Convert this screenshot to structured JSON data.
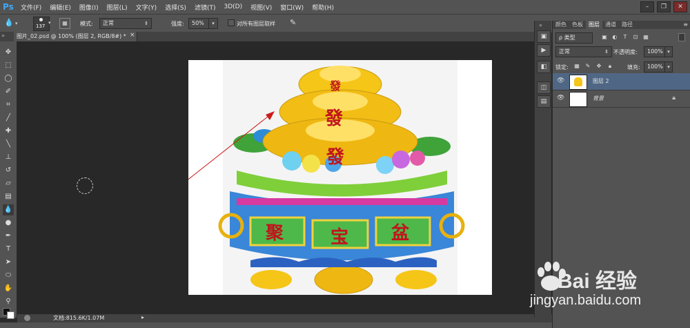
{
  "app": {
    "logo": "Ps",
    "menu": [
      "文件(F)",
      "编辑(E)",
      "图像(I)",
      "图层(L)",
      "文字(Y)",
      "选择(S)",
      "滤镜(T)",
      "3D(D)",
      "视图(V)",
      "窗口(W)",
      "帮助(H)"
    ]
  },
  "options": {
    "brush_size": "137",
    "mode_label": "模式:",
    "mode_value": "正常",
    "strength_label": "强度:",
    "strength_value": "50%",
    "sample_all_label": "对所有图层取样"
  },
  "document": {
    "tab_title": "图片_02.psd @ 100% (图层 2, RGB/8#) *",
    "status_text": "文档:815.6K/1.07M"
  },
  "artwork": {
    "characters": [
      "發",
      "發",
      "發"
    ],
    "pot_labels": [
      "聚",
      "宝",
      "盆"
    ]
  },
  "layers_panel": {
    "tabs": [
      "颜色",
      "色板",
      "图层",
      "通道",
      "路径"
    ],
    "active_tab": "图层",
    "filter_label": "ρ 类型",
    "blend_mode": "正常",
    "opacity_label": "不透明度:",
    "opacity_value": "100%",
    "lock_label": "锁定:",
    "fill_label": "填充:",
    "fill_value": "100%",
    "layers": [
      {
        "name": "图层 2",
        "selected": true
      },
      {
        "name": "背景",
        "selected": false,
        "locked": true
      }
    ]
  },
  "watermark": {
    "brand": "Bai 经验",
    "url": "jingyan.baidu.com"
  },
  "colors": {
    "chrome": "#535353",
    "dark": "#282828",
    "selection": "#4f6784",
    "arrow": "#cc1b1b",
    "gold": "#f5c518",
    "red_text": "#c0141c"
  }
}
